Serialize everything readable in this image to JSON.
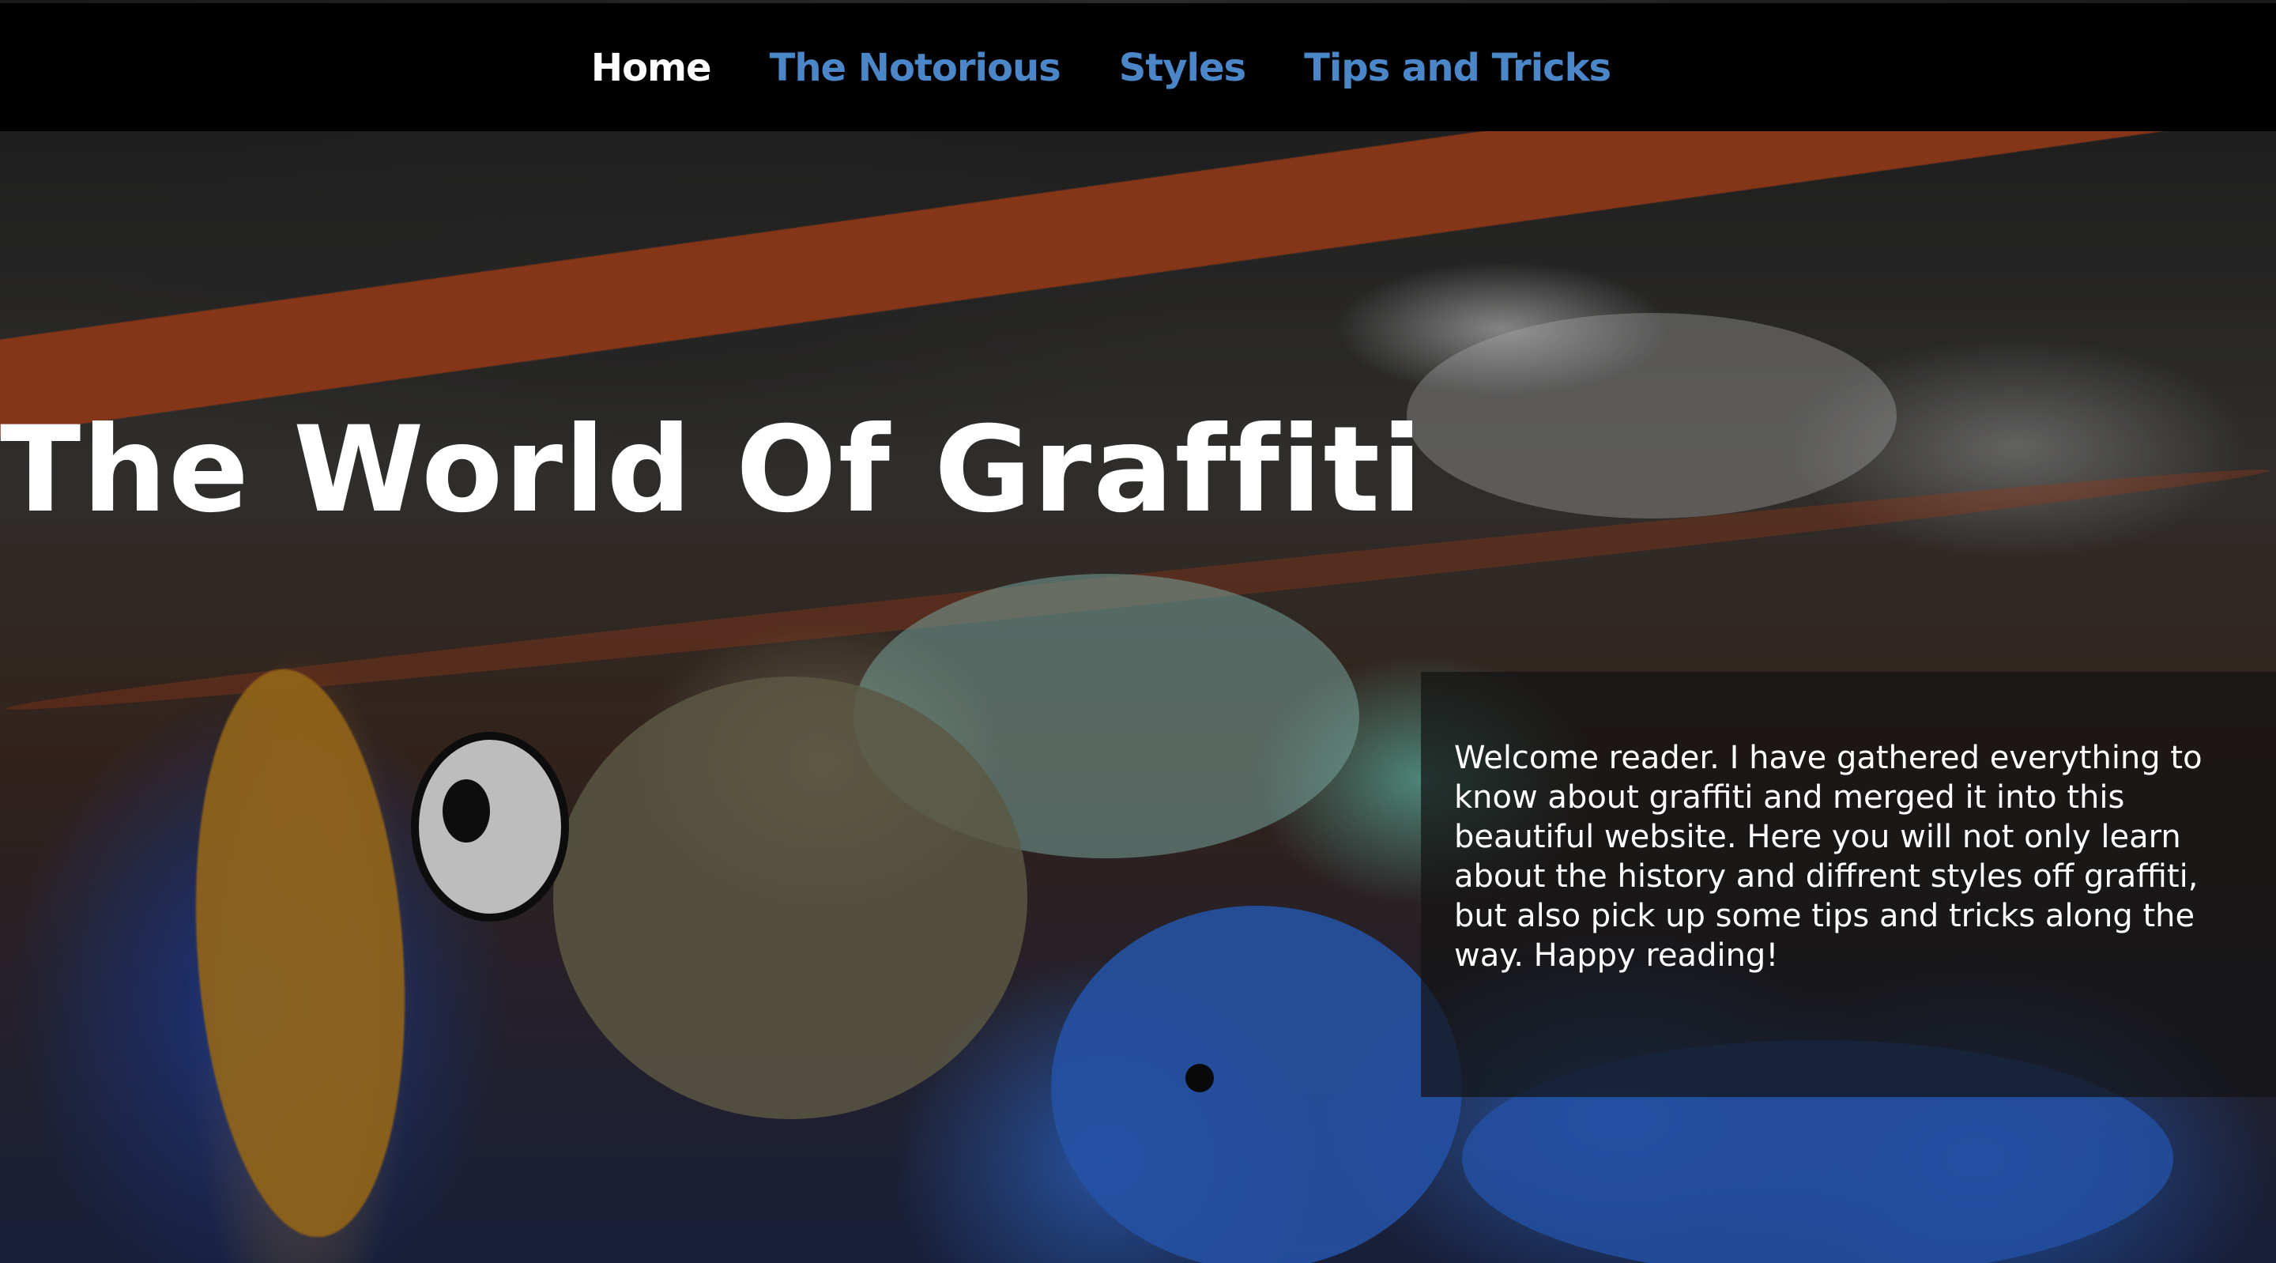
{
  "nav": {
    "items": [
      {
        "label": "Home",
        "active": true
      },
      {
        "label": "The Notorious",
        "active": false
      },
      {
        "label": "Styles",
        "active": false
      },
      {
        "label": "Tips and Tricks",
        "active": false
      }
    ]
  },
  "hero": {
    "title": "The World Of Graffiti",
    "intro": "Welcome reader. I have gathered everything to know about graffiti and merged it into this beautiful website. Here you will not only learn about the history and diffrent styles off graffiti, but also pick up some tips and tricks along the way. Happy reading!"
  },
  "colors": {
    "nav_background": "#000000",
    "nav_link": "#4a86c8",
    "nav_link_active": "#ffffff",
    "title_text": "#ffffff",
    "intro_box": "rgba(20,20,20,0.72)"
  }
}
